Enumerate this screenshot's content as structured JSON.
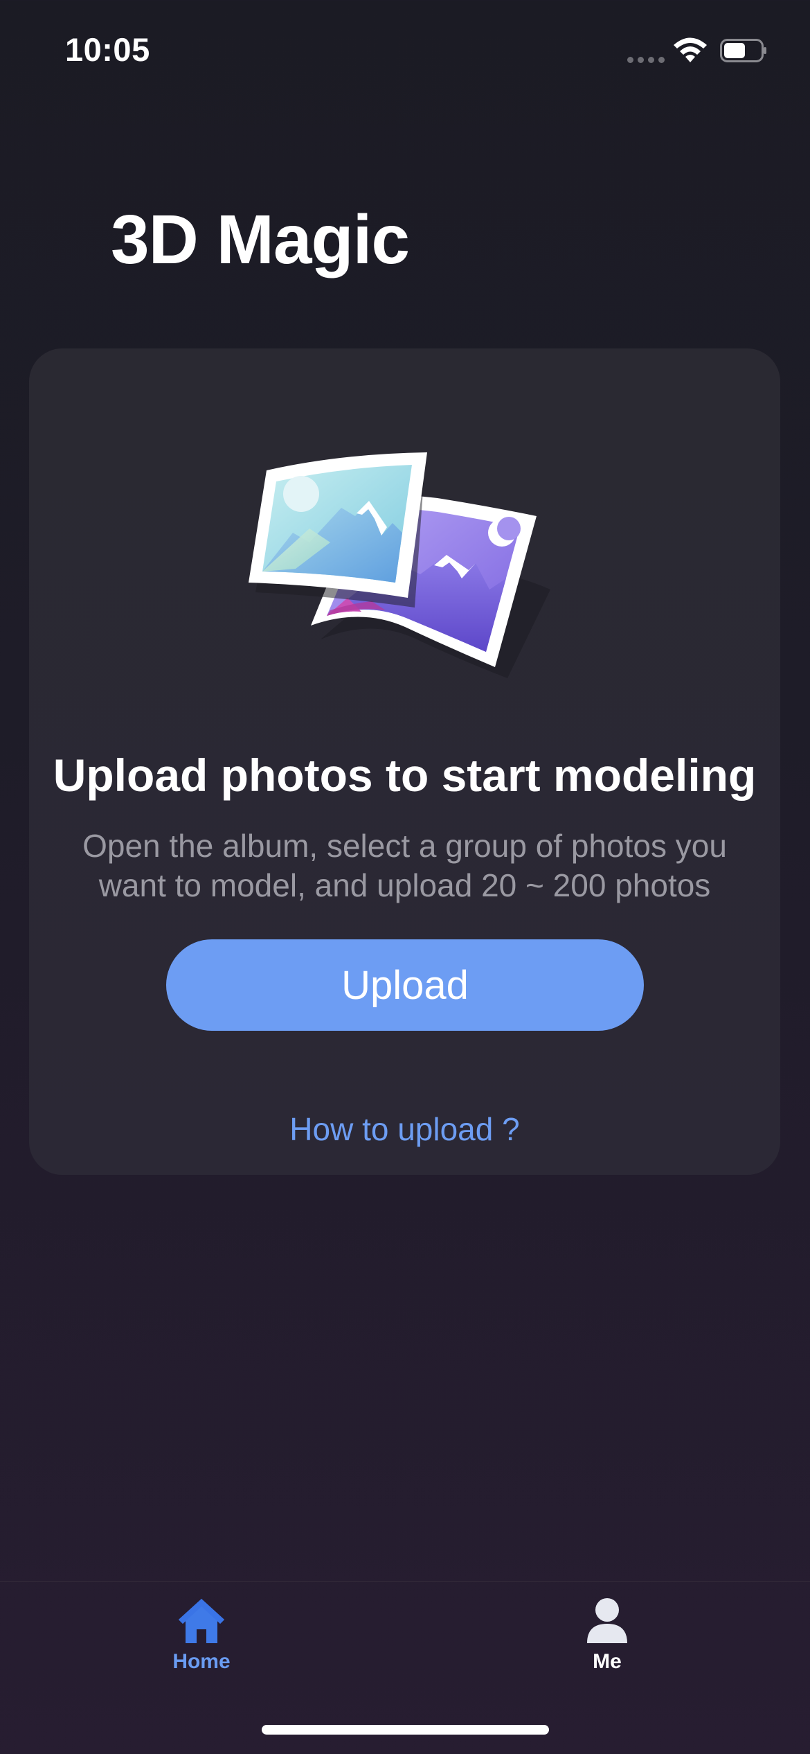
{
  "status_bar": {
    "time": "10:05",
    "icons": [
      "cellular-signal-icon",
      "wifi-icon",
      "battery-icon"
    ]
  },
  "header": {
    "title": "3D Magic"
  },
  "upload_card": {
    "illustration": "photos-illustration",
    "heading": "Upload photos to start modeling",
    "description": "Open the album, select a group of photos you want to model, and upload 20 ~ 200 photos",
    "upload_button_label": "Upload",
    "help_link": "How to upload ?"
  },
  "tab_bar": {
    "tabs": [
      {
        "label": "Home",
        "icon": "home-icon",
        "active": true
      },
      {
        "label": "Me",
        "icon": "person-icon",
        "active": false
      }
    ]
  },
  "colors": {
    "accent": "#6d9df3",
    "active_tab": "#6a9cf2",
    "card_bg": "#2a2932",
    "muted_text": "#9a99a2"
  }
}
